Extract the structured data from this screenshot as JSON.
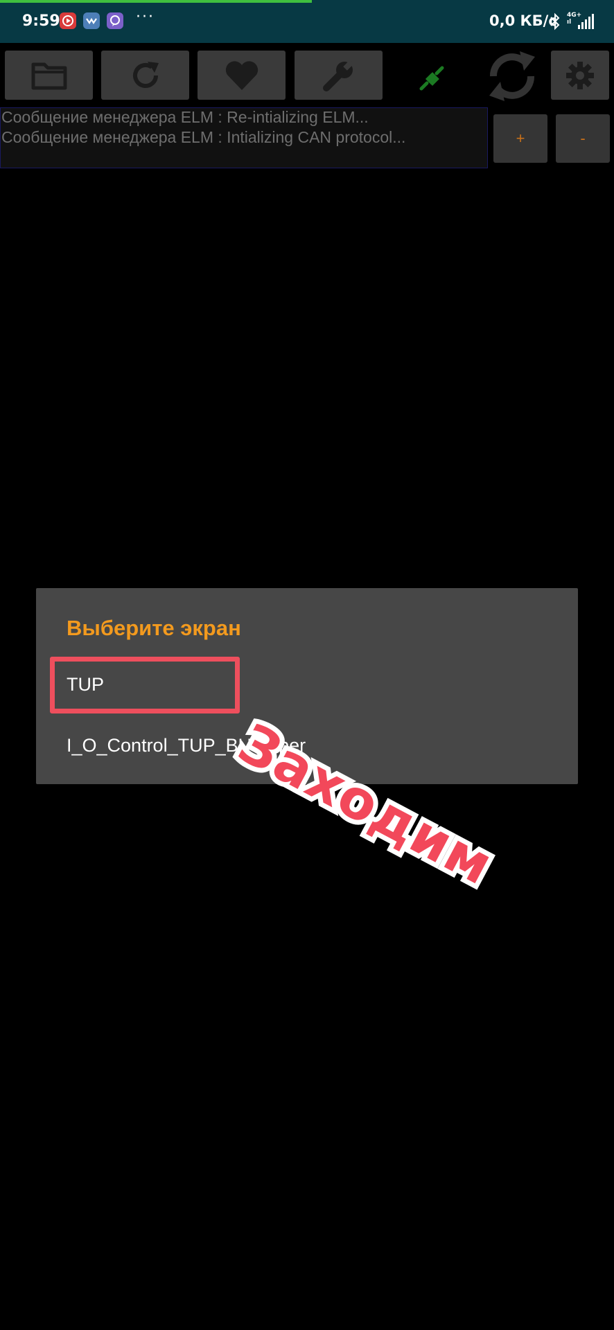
{
  "status_bar": {
    "time": "9:59",
    "more_indicator": "···",
    "net_speed": "0,0 КБ/с",
    "network_type_top": "4G+",
    "network_type_bottom": "ıl",
    "notifications": [
      "youtube-icon",
      "vk-icon",
      "viber-icon"
    ],
    "progress_color": "#3fbf3f"
  },
  "toolbar": {
    "buttons": [
      "folder-icon",
      "refresh-icon",
      "heart-icon",
      "wrench-icon"
    ],
    "status_icon": "plug-icon",
    "sync_icon": "sync-icon",
    "settings_icon": "gear-icon"
  },
  "log": {
    "lines": [
      "Сообщение менеджера ELM : Re-intializing ELM...",
      "Сообщение менеджера ELM : Intializing CAN protocol..."
    ]
  },
  "zoom": {
    "plus_label": "+",
    "minus_label": "-"
  },
  "dialog": {
    "title": "Выберите экран",
    "items": [
      "TUP",
      "I_O_Control_TUP_BU Wiper"
    ],
    "title_color": "#f39a1e"
  },
  "annotation": {
    "text": "Заходим",
    "color": "#f2485a"
  }
}
